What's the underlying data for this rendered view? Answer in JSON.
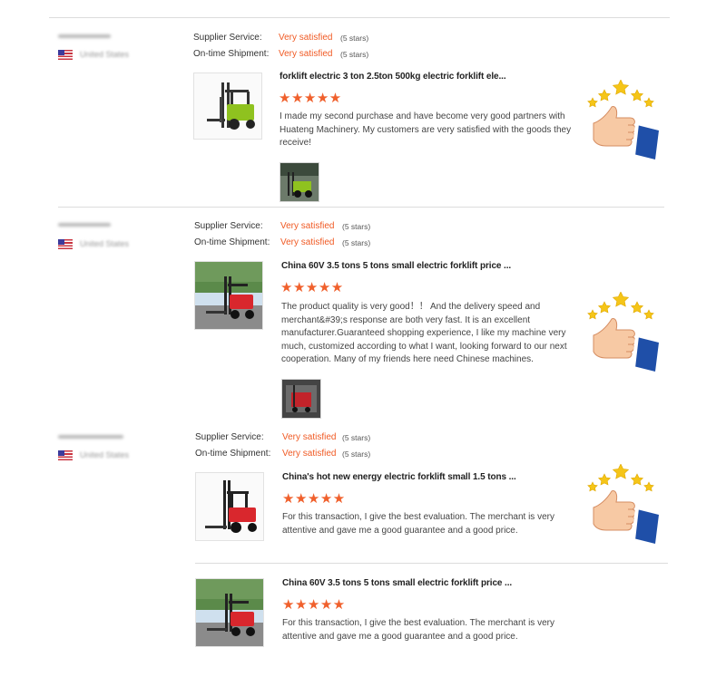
{
  "reviews": [
    {
      "labels": {
        "supplier_service": "Supplier Service:",
        "ontime_shipment": "On-time Shipment:"
      },
      "supplier_service": {
        "value": "Very satisfied",
        "stars": "(5 stars)"
      },
      "ontime_shipment": {
        "value": "Very satisfied",
        "stars": "(5 stars)"
      },
      "product_title": "forklift electric 3 ton 2.5ton 500kg electric forklift ele...",
      "rating": "★★★★★",
      "text": "I made my second purchase and have become very good partners with Huateng Machinery. My customers are very satisfied with the goods they receive!",
      "product_color": "#8fc21f"
    },
    {
      "labels": {
        "supplier_service": "Supplier Service:",
        "ontime_shipment": "On-time Shipment:"
      },
      "supplier_service": {
        "value": "Very satisfied",
        "stars": "(5 stars)"
      },
      "ontime_shipment": {
        "value": "Very satisfied",
        "stars": "(5 stars)"
      },
      "product_title": "China 60V 3.5 tons 5 tons small electric forklift price ...",
      "rating": "★★★★★",
      "text": "The product quality is very good！！ And the delivery speed and merchant&#39;s response are both very fast. It is an excellent manufacturer.Guaranteed shopping experience, I like my machine very much, customized according to what I want, looking forward to our next cooperation. Many of my friends here need Chinese machines.",
      "product_color": "#d9272d"
    },
    {
      "labels": {
        "supplier_service": "Supplier Service:",
        "ontime_shipment": "On-time Shipment:"
      },
      "supplier_service": {
        "value": "Very satisfied",
        "stars": "(5 stars)"
      },
      "ontime_shipment": {
        "value": "Very satisfied",
        "stars": "(5 stars)"
      },
      "product_title": "China's hot new energy electric forklift small 1.5 tons ...",
      "rating": "★★★★★",
      "text": "For this transaction, I give the best evaluation. The merchant is very attentive and gave me a good guarantee and a good price.",
      "product_color": "#d9272d"
    },
    {
      "product_title": "China 60V 3.5 tons 5 tons small electric forklift price ...",
      "rating": "★★★★★",
      "text": "For this transaction, I give the best evaluation. The merchant is very attentive and gave me a good guarantee and a good price.",
      "product_color": "#d9272d"
    }
  ],
  "colors": {
    "accent": "#f05a24",
    "star": "#f0602c",
    "badge_star": "#f5c518",
    "sleeve": "#1f4fa8"
  },
  "icons": {
    "badge": "thumbs-up-five-stars-icon",
    "flag": "us-flag-icon"
  }
}
